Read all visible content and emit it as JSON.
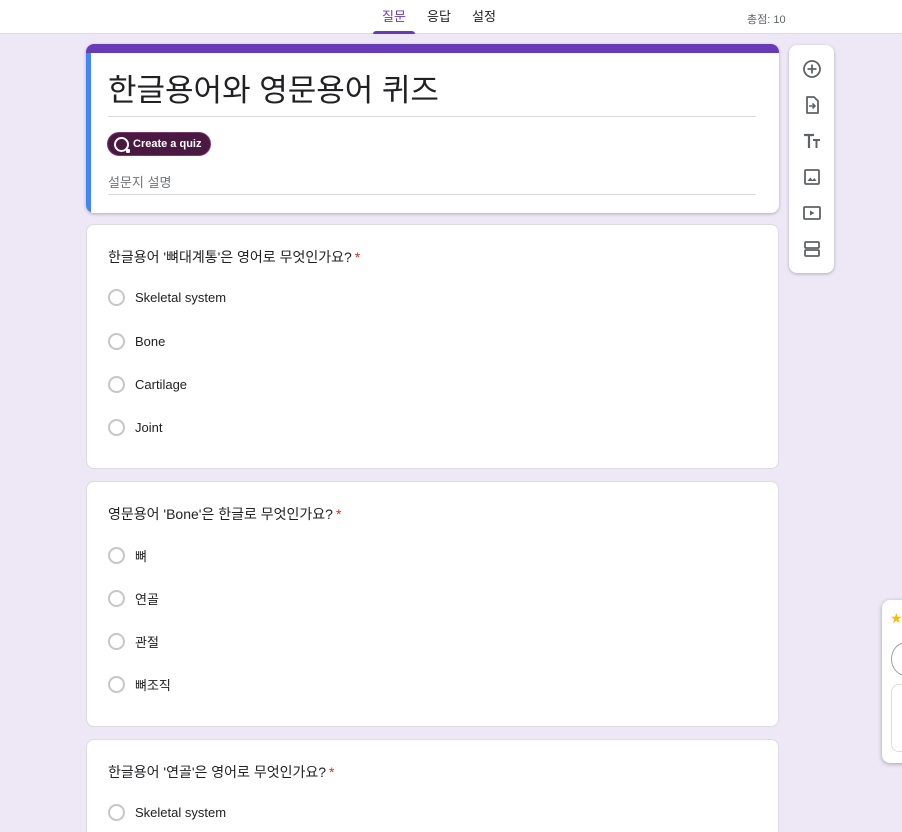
{
  "tabs": [
    {
      "label": "질문",
      "active": true
    },
    {
      "label": "응답",
      "active": false
    },
    {
      "label": "설정",
      "active": false
    }
  ],
  "total_score": "총점: 10",
  "form": {
    "title": "한글용어와 영문용어 퀴즈",
    "quiz_chip_label": "Create a quiz",
    "description_placeholder": "설문지 설명"
  },
  "questions": [
    {
      "title": "한글용어 '뼈대계통'은 영어로 무엇인가요?",
      "required_mark": "*",
      "options": [
        "Skeletal system",
        "Bone",
        "Cartilage",
        "Joint"
      ]
    },
    {
      "title": "영문용어 'Bone'은 한글로 무엇인가요?",
      "required_mark": "*",
      "options": [
        "뼈",
        "연골",
        "관절",
        "뼈조직"
      ]
    },
    {
      "title": "한글용어 '연골'은 영어로 무엇인가요?",
      "required_mark": "*",
      "options": [
        "Skeletal system"
      ]
    }
  ],
  "toolbar": {
    "icons": [
      "add-question-icon",
      "import-questions-icon",
      "add-title-icon",
      "add-image-icon",
      "add-video-icon",
      "add-section-icon"
    ]
  },
  "colors": {
    "accent": "#673ab7",
    "background": "#ede7f6",
    "title_left_strip": "#4285f4",
    "required": "#d93025",
    "quiz_chip": "#4a1942"
  }
}
